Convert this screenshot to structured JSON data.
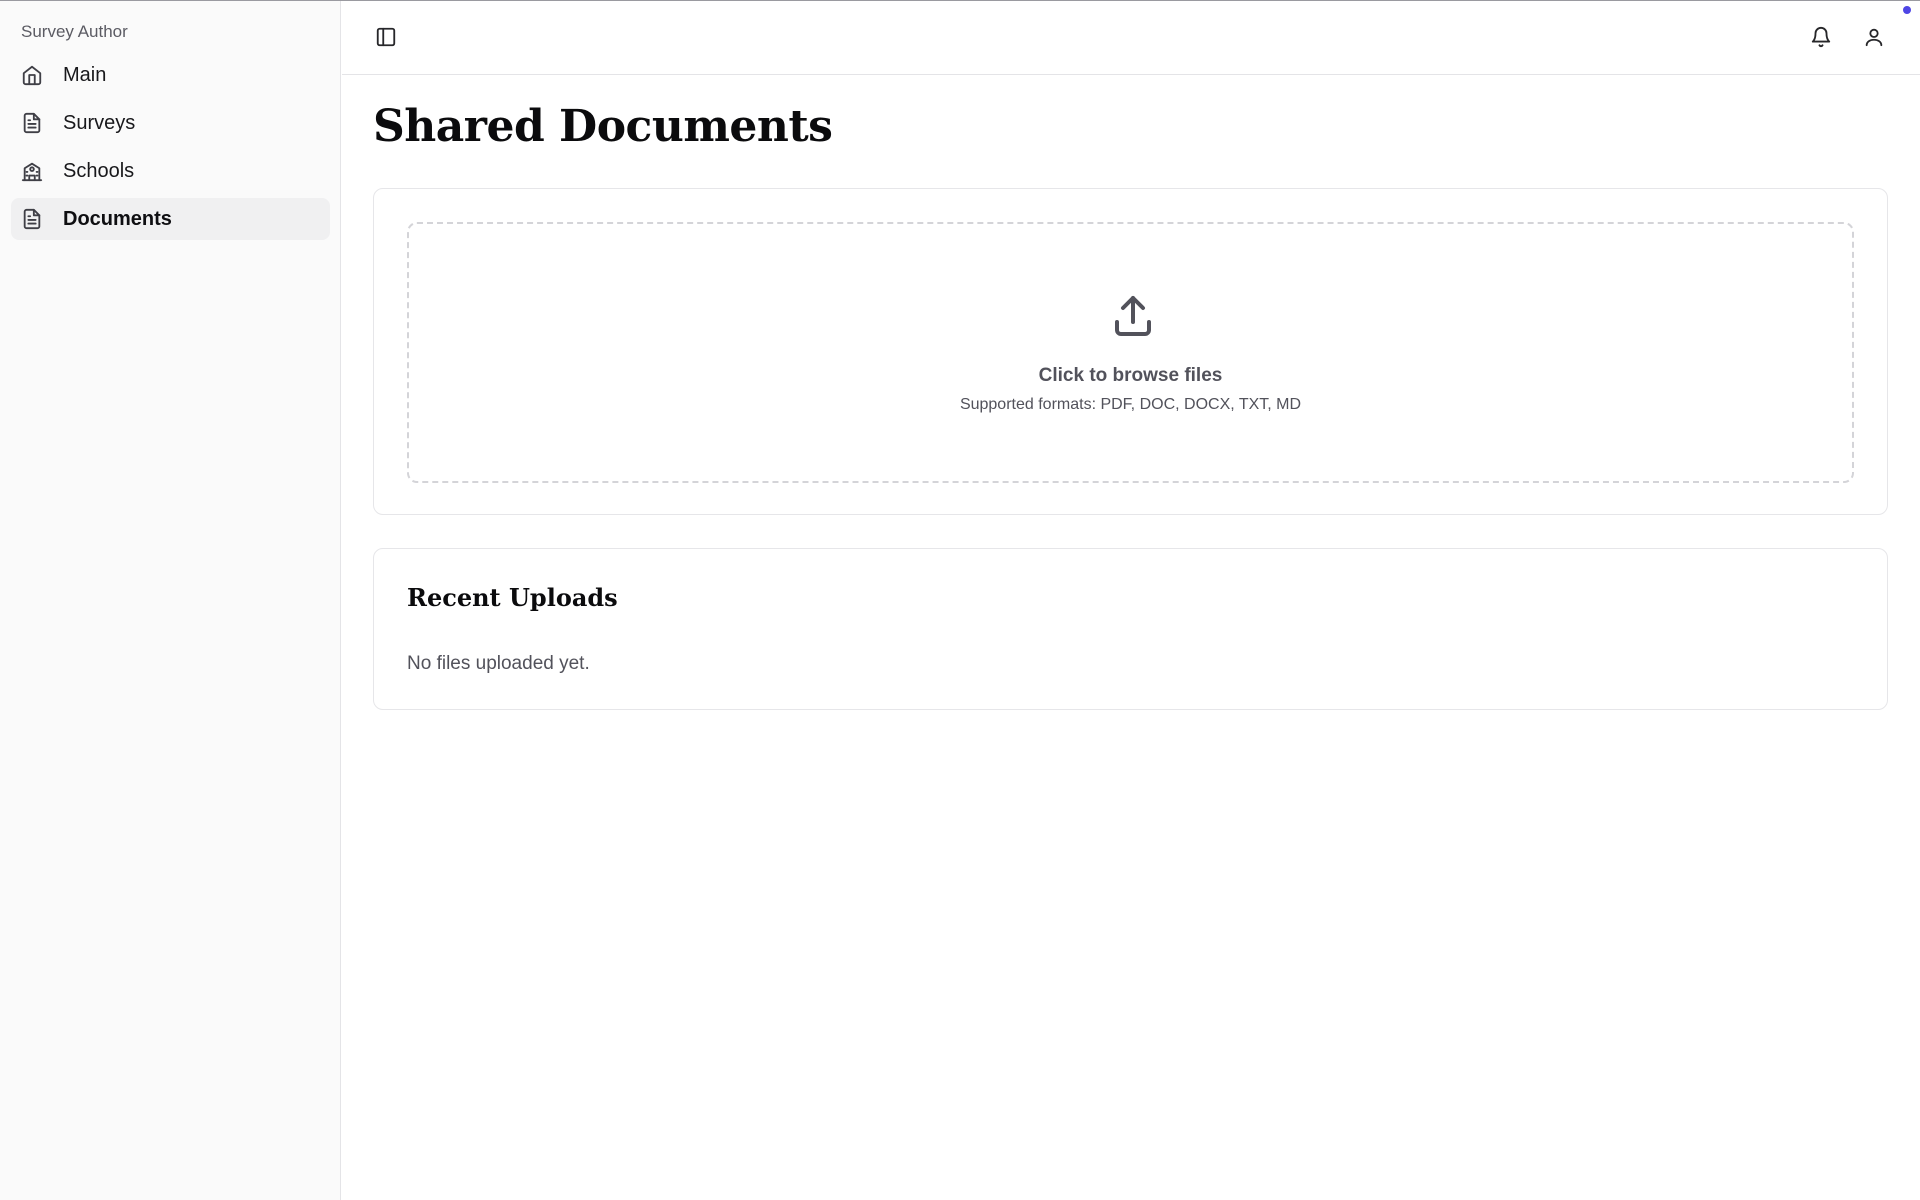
{
  "sidebar": {
    "brand": "Survey Author",
    "items": [
      {
        "label": "Main",
        "icon": "home-icon",
        "active": false
      },
      {
        "label": "Surveys",
        "icon": "file-text-icon",
        "active": false
      },
      {
        "label": "Schools",
        "icon": "school-icon",
        "active": false
      },
      {
        "label": "Documents",
        "icon": "file-text-icon",
        "active": true
      }
    ]
  },
  "topbar": {
    "toggle_icon": "sidebar-toggle-icon",
    "notification_icon": "bell-icon",
    "user_icon": "user-icon",
    "notification_dot_color": "#4f46e5"
  },
  "main": {
    "title": "Shared Documents",
    "upload": {
      "icon": "upload-icon",
      "prompt": "Click to browse files",
      "formats": "Supported formats: PDF, DOC, DOCX, TXT, MD"
    },
    "recent": {
      "title": "Recent Uploads",
      "empty": "No files uploaded yet."
    }
  }
}
